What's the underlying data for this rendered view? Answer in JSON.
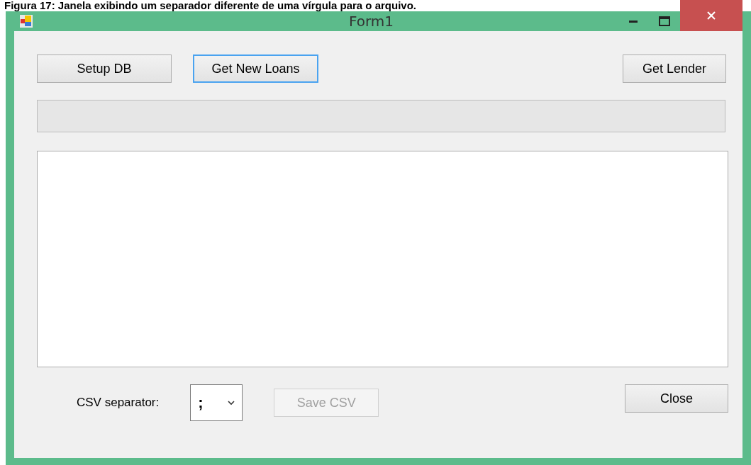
{
  "caption": "Figura 17: Janela exibindo um separador diferente de uma vírgula para o arquivo.",
  "window": {
    "title": "Form1"
  },
  "top_buttons": [
    {
      "label": "Setup DB",
      "focused": false
    },
    {
      "label": "Get New Loans",
      "focused": true
    },
    {
      "label": "Get Lender",
      "focused": false
    }
  ],
  "separator": {
    "label": "CSV separator:",
    "value": ";"
  },
  "save_button": {
    "label": "Save CSV",
    "disabled": true
  },
  "close_button": {
    "label": "Close",
    "disabled": false
  }
}
